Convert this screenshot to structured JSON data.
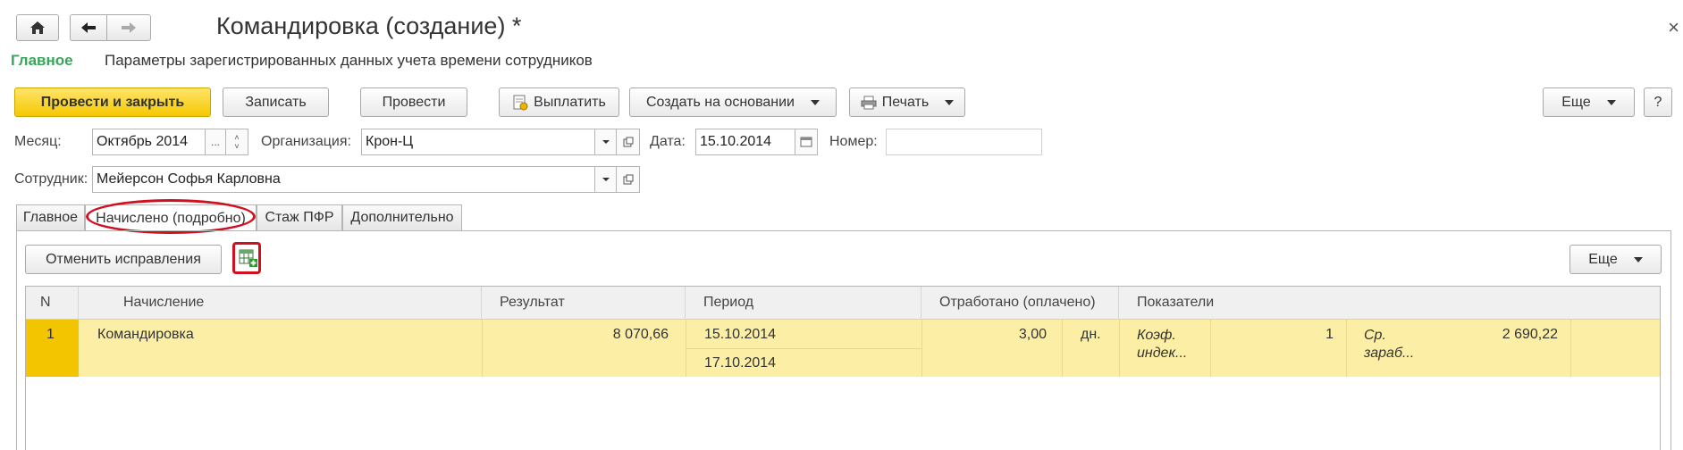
{
  "window": {
    "title": "Командировка (создание) *",
    "close_glyph": "×"
  },
  "nav": {
    "home_icon": "home-icon",
    "back_icon": "arrow-left-icon",
    "forward_icon": "arrow-right-icon"
  },
  "sections": {
    "main": "Главное",
    "params": "Параметры зарегистрированных данных учета времени сотрудников"
  },
  "toolbar": {
    "post_close": "Провести и закрыть",
    "save": "Записать",
    "post": "Провести",
    "pay": "Выплатить",
    "create_based": "Создать на основании",
    "print": "Печать",
    "more": "Еще",
    "help": "?"
  },
  "form": {
    "month_label": "Месяц:",
    "month_value": "Октябрь 2014",
    "month_dots": "...",
    "org_label": "Организация:",
    "org_value": "Крон-Ц",
    "date_label": "Дата:",
    "date_value": "15.10.2014",
    "number_label": "Номер:",
    "number_value": "",
    "employee_label": "Сотрудник:",
    "employee_value": "Мейерсон Софья Карловна"
  },
  "tabs": [
    {
      "label": "Главное"
    },
    {
      "label": "Начислено (подробно)"
    },
    {
      "label": "Стаж ПФР"
    },
    {
      "label": "Дополнительно"
    }
  ],
  "active_tab": "Начислено (подробно)",
  "panel": {
    "cancel_corrections": "Отменить исправления",
    "more": "Еще"
  },
  "table": {
    "columns": [
      "N",
      "Начисление",
      "Результат",
      "Период",
      "Отработано (оплачено)",
      "Показатели"
    ],
    "rows": [
      {
        "n": "1",
        "accrual": "Командировка",
        "result": "8 070,66",
        "period_from": "15.10.2014",
        "period_to": "17.10.2014",
        "worked": "3,00",
        "worked_unit": "дн.",
        "ind1_name": "Коэф. индек...",
        "ind1_value": "1",
        "ind2_name": "Ср. зараб...",
        "ind2_value": "2 690,22"
      }
    ]
  },
  "colors": {
    "accent_green": "#3aa55a",
    "primary_yellow": "#f5c800",
    "row_highlight": "#fcefa5",
    "marker_red": "#d01020"
  }
}
